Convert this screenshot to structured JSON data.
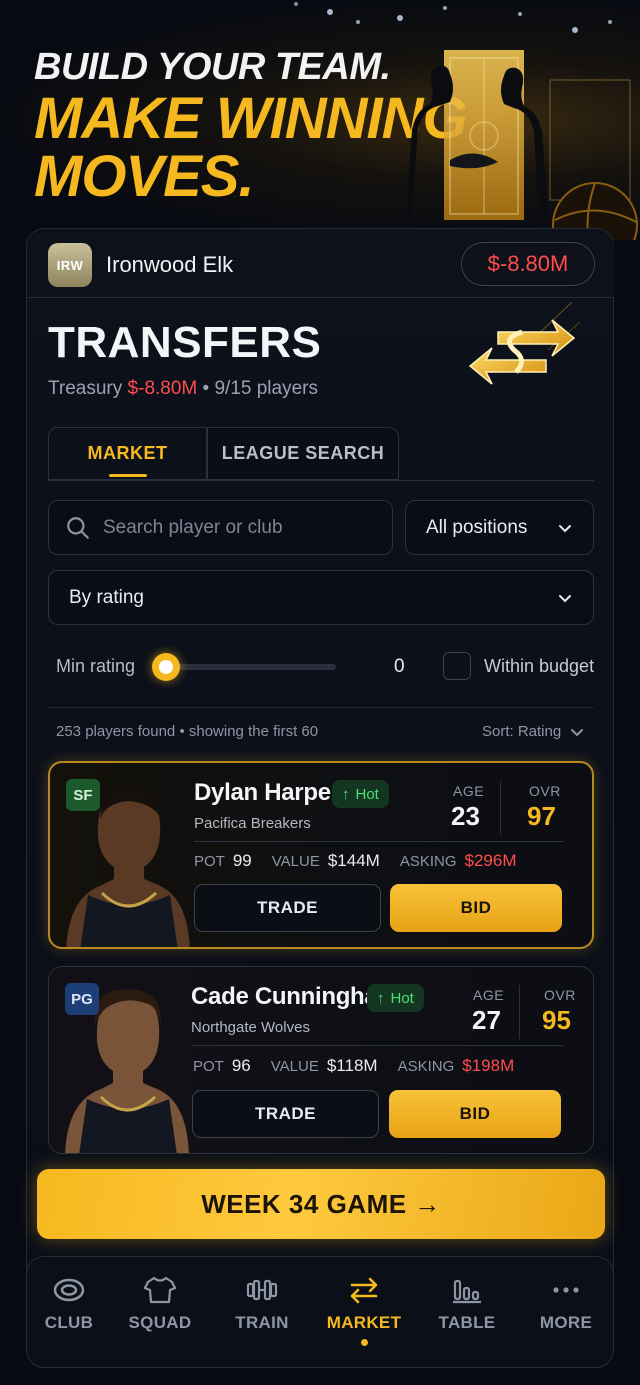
{
  "hero": {
    "line1": "BUILD YOUR TEAM.",
    "line2": "MAKE WINNING",
    "line3": "MOVES."
  },
  "club": {
    "badge": "IRW",
    "name": "Ironwood Elk",
    "balance": "$-8.80M"
  },
  "page": {
    "title": "TRANSFERS",
    "treasury_label": "Treasury",
    "treasury_value": "$-8.80M",
    "roster": "9/15 players"
  },
  "tabs": [
    {
      "label": "MARKET",
      "active": true
    },
    {
      "label": "LEAGUE SEARCH",
      "active": false
    }
  ],
  "filters": {
    "search_placeholder": "Search player or club",
    "position": "All positions",
    "sort": "By rating",
    "min_rating_label": "Min rating",
    "min_rating_value": "0",
    "within_budget_label": "Within budget",
    "within_budget_checked": false
  },
  "results": {
    "summary": "253 players found",
    "showing": "showing the first 60",
    "sort_label": "Sort: Rating"
  },
  "players": [
    {
      "position": "SF",
      "name": "Dylan Harper",
      "tag": "Hot",
      "club": "Pacifica Breakers",
      "age_label": "AGE",
      "age": "23",
      "ovr_label": "OVR",
      "ovr": "97",
      "pot_label": "POT",
      "pot": "99",
      "value_label": "VALUE",
      "value": "$144M",
      "asking_label": "ASKING",
      "asking": "$296M",
      "trade_label": "TRADE",
      "bid_label": "BID"
    },
    {
      "position": "PG",
      "name": "Cade Cunningham",
      "tag": "Hot",
      "club": "Northgate Wolves",
      "age_label": "AGE",
      "age": "27",
      "ovr_label": "OVR",
      "ovr": "95",
      "pot_label": "POT",
      "pot": "96",
      "value_label": "VALUE",
      "value": "$118M",
      "asking_label": "ASKING",
      "asking": "$198M",
      "trade_label": "TRADE",
      "bid_label": "BID"
    }
  ],
  "cta": {
    "label": "WEEK 34 GAME →"
  },
  "nav": [
    {
      "label": "CLUB",
      "icon": "club-icon"
    },
    {
      "label": "SQUAD",
      "icon": "shirt-icon"
    },
    {
      "label": "TRAIN",
      "icon": "dumbbell-icon"
    },
    {
      "label": "MARKET",
      "icon": "swap-icon",
      "active": true
    },
    {
      "label": "TABLE",
      "icon": "bar-chart-icon"
    },
    {
      "label": "MORE",
      "icon": "more-icon"
    }
  ],
  "colors": {
    "accent": "#f6b81f",
    "negative": "#ff4d4d",
    "hot": "#4be07a",
    "background": "#070a12"
  }
}
